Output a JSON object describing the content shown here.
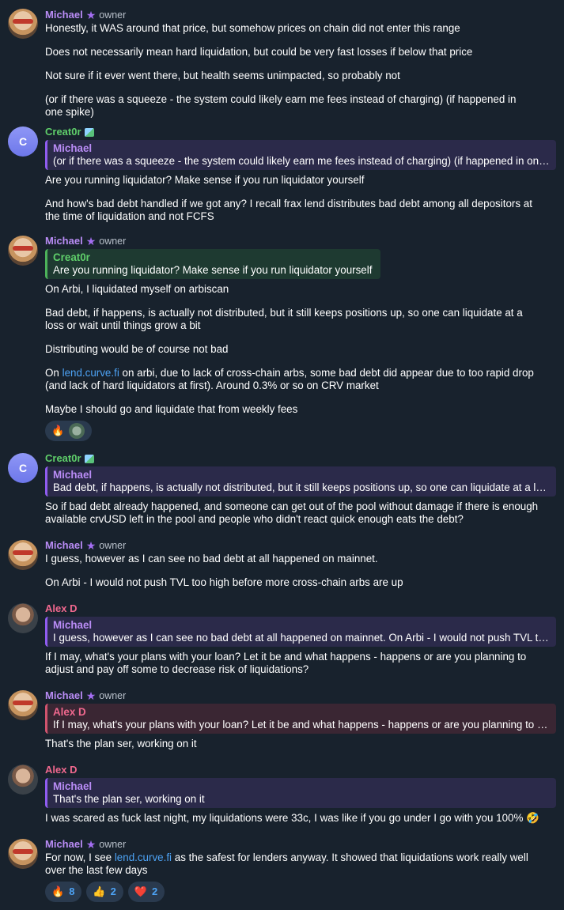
{
  "messages": [
    {
      "author": "Michael",
      "role": "owner",
      "lines": [
        "Honestly, it WAS around that price, but somehow prices on chain did not enter this range",
        "",
        "Does not necessarily mean hard liquidation, but could be very fast losses if below that price",
        "",
        "Not sure if it ever went there, but health seems unimpacted, so probably not",
        "",
        "(or if there was a squeeze - the system could likely earn me fees instead of charging) (if happened in",
        "one spike)"
      ]
    },
    {
      "author": "Creat0r",
      "avatar_letter": "C",
      "quote": {
        "name": "Michael",
        "text": "(or if there was a squeeze - the system could likely earn me fees instead of charging) (if happened in one spike)"
      },
      "lines": [
        "Are you running liquidator? Make sense if you run liquidator yourself",
        "",
        "And how's bad debt handled if we got any? I recall frax lend distributes bad debt among all depositors at",
        "the time of liquidation and not FCFS"
      ]
    },
    {
      "author": "Michael",
      "role": "owner",
      "quote": {
        "name": "Creat0r",
        "text": "Are you running liquidator? Make sense if you run liquidator yourself"
      },
      "lines": [
        "On Arbi, I liquidated myself on arbiscan",
        "",
        "Bad debt, if happens, is actually not distributed, but it still keeps positions up, so one can liquidate at a",
        "loss or wait until things grow a bit",
        "",
        "Distributing would be of course not bad"
      ],
      "link_line": {
        "prefix": "On ",
        "link": "lend.curve.fi",
        "suffix": " on arbi, due to lack of cross-chain arbs, some bad debt did appear due to too rapid drop"
      },
      "lines_after": [
        "(and lack of hard liquidators at first). Around 0.3% or so on CRV market",
        "",
        "Maybe I should go and liquidate that from weekly fees"
      ],
      "reactions": [
        {
          "emoji": "🔥"
        }
      ]
    },
    {
      "author": "Creat0r",
      "avatar_letter": "C",
      "quote": {
        "name": "Michael",
        "text": "Bad debt, if happens, is actually not distributed, but it still keeps positions up, so one can liquidate at a loss or wait until things grow a bit"
      },
      "lines": [
        "So if bad debt already happened, and someone can get out of the pool without damage if there is enough",
        "available crvUSD left in the pool and people who didn't react quick enough eats the debt?"
      ]
    },
    {
      "author": "Michael",
      "role": "owner",
      "lines": [
        "I guess, however as I can see no bad debt at all happened on mainnet.",
        "",
        "On Arbi - I would not push TVL too high before more cross-chain arbs are up"
      ]
    },
    {
      "author": "Alex D",
      "quote": {
        "name": "Michael",
        "text": "I guess, however as I can see no bad debt at all happened on mainnet.  On Arbi - I would not push TVL too high before more cross-chain arbs are up"
      },
      "lines": [
        "If I may, what's your plans with your loan? Let it be and what happens - happens or are you planning to",
        "adjust and pay off some to decrease risk of liquidations?"
      ]
    },
    {
      "author": "Michael",
      "role": "owner",
      "quote": {
        "name": "Alex D",
        "text": "If I may, what's your plans with your loan? Let it be and what happens - happens or are you planning to adjust and pay off some"
      },
      "lines": [
        "That's the plan ser, working on it"
      ]
    },
    {
      "author": "Alex D",
      "quote": {
        "name": "Michael",
        "text": "That's the plan ser, working on it"
      },
      "lines": [
        "I was scared as fuck last night, my liquidations were 33c, I was like if you go under I go with you 100% 🤣"
      ]
    },
    {
      "author": "Michael",
      "role": "owner",
      "link_line": {
        "prefix": "For now, I see ",
        "link": "lend.curve.fi",
        "suffix": " as the safest for lenders anyway. It showed that liquidations work really well"
      },
      "lines_after": [
        "over the last few days"
      ],
      "reactions": [
        {
          "emoji": "🔥",
          "count": "8"
        },
        {
          "emoji": "👍",
          "count": "2"
        },
        {
          "emoji": "❤️",
          "count": "2"
        }
      ]
    }
  ]
}
